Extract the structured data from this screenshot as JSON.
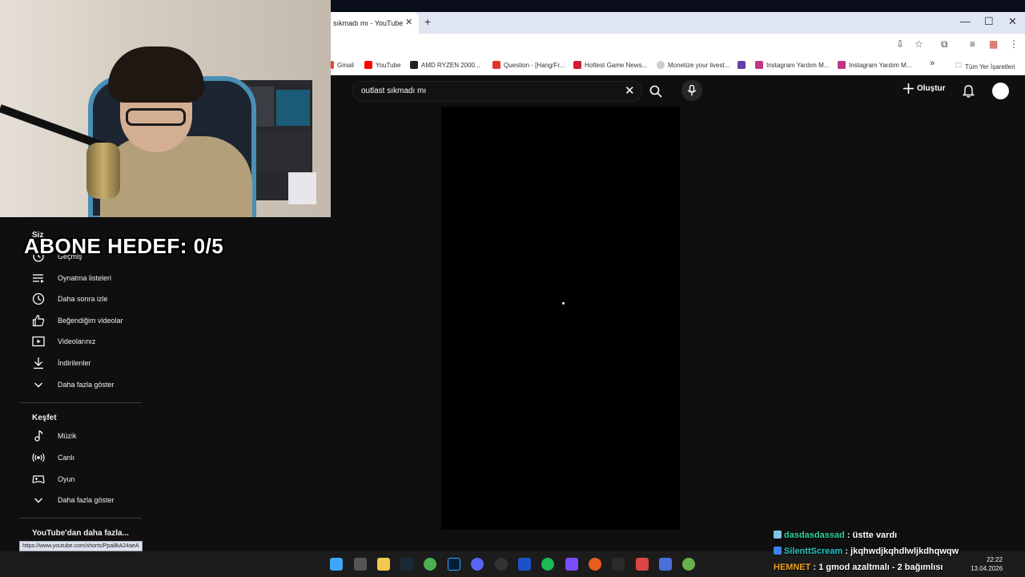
{
  "browser": {
    "tab_title": "sıkmadı mı - YouTube",
    "tab_close": "✕",
    "new_tab": "+",
    "window_controls": [
      "—",
      "☐",
      "✕"
    ],
    "bookmarks": [
      {
        "label": "Gmail",
        "color": "#ea4335"
      },
      {
        "label": "YouTube",
        "color": "#ff0000"
      },
      {
        "label": "AMD RYZEN 2000...",
        "color": "#222222"
      },
      {
        "label": "Question - [Hang/Fr...",
        "color": "#e0332b"
      },
      {
        "label": "Hottest Game News...",
        "color": "#d01f2f"
      },
      {
        "label": "Monetize your livest...",
        "color": "#cccccc"
      },
      {
        "label": "Instagram Yardım M...",
        "color": "#c13584"
      },
      {
        "label": "Instagram Yardım M...",
        "color": "#c13584"
      }
    ],
    "bookmarks_more": "»",
    "all_bookmarks": "Tüm Yer İşaretleri",
    "status_url": "https://www.youtube.com/shorts/Ppa8kA24aeA"
  },
  "youtube": {
    "search_value": "outlast sıkmadı mı",
    "create_label": "Oluştur",
    "sidebar": {
      "you_header": "Siz",
      "you_items": [
        {
          "label": "Geçmiş",
          "icon": "history-icon"
        },
        {
          "label": "Oynatma listeleri",
          "icon": "playlist-icon"
        },
        {
          "label": "Daha sonra izle",
          "icon": "clock-icon"
        },
        {
          "label": "Beğendiğim videolar",
          "icon": "thumbs-up-icon"
        },
        {
          "label": "Videolarınız",
          "icon": "video-icon"
        },
        {
          "label": "İndirilenler",
          "icon": "download-icon"
        },
        {
          "label": "Daha fazla göster",
          "icon": "chevron-down-icon"
        }
      ],
      "explore_header": "Keşfet",
      "explore_items": [
        {
          "label": "Müzik",
          "icon": "music-icon"
        },
        {
          "label": "Canlı",
          "icon": "live-icon"
        },
        {
          "label": "Oyun",
          "icon": "gaming-icon"
        },
        {
          "label": "Daha fazla göster",
          "icon": "chevron-down-icon"
        }
      ],
      "more_from_header": "YouTube'dan daha fazla..."
    }
  },
  "stream_overlay": {
    "goal_text": "ABONE HEDEF:  0/5",
    "chat": [
      {
        "name": "dasdasdassad",
        "message": " : üstte vardı",
        "color": "#2fd1a0"
      },
      {
        "name": "SilenttScream",
        "message": " : jkqhwdjkqhdlwljkdhqwqw",
        "color": "#27c4c4"
      },
      {
        "name": "HEMNET",
        "message": " : 1 gmod azaltmalı - 2 bağımlısı",
        "color": "#f0a020"
      }
    ]
  },
  "taskbar": {
    "time": "22:22",
    "date": "13.04.2026"
  }
}
